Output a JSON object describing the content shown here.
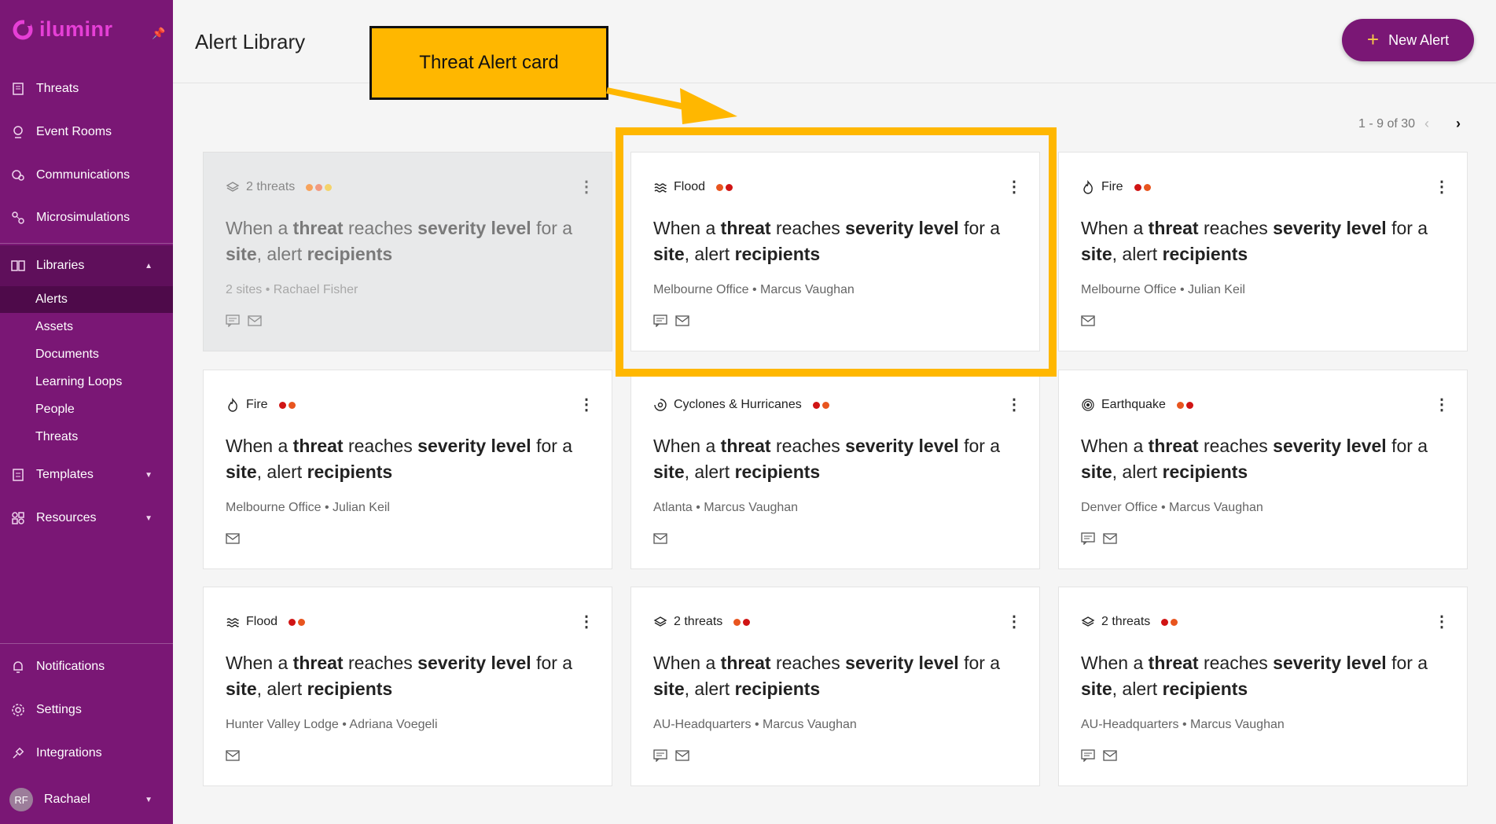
{
  "sidebar": {
    "brand": "iluminr",
    "items": [
      {
        "label": "Threats",
        "icon": "threats-icon"
      },
      {
        "label": "Event Rooms",
        "icon": "event-rooms-icon"
      },
      {
        "label": "Communications",
        "icon": "communications-icon"
      },
      {
        "label": "Microsimulations",
        "icon": "microsimulations-icon"
      },
      {
        "label": "Libraries",
        "icon": "libraries-icon"
      }
    ],
    "library_sub": [
      "Alerts",
      "Assets",
      "Documents",
      "Learning Loops",
      "People",
      "Threats"
    ],
    "templates": "Templates",
    "resources": "Resources",
    "bottom": [
      "Notifications",
      "Settings",
      "Integrations"
    ],
    "user": {
      "initials": "RF",
      "name": "Rachael"
    }
  },
  "header": {
    "title": "Alert Library",
    "new_alert": "New Alert"
  },
  "pagination": {
    "text": "1 - 9 of 30"
  },
  "annotation": {
    "label": "Threat Alert card",
    "color": "#ffb700"
  },
  "rule_text": {
    "when": "When a ",
    "threat": "threat",
    "reaches": " reaches ",
    "severity": "severity level",
    "for": " for a",
    "site": "site",
    "comma": ", alert ",
    "recipients": "recipients"
  },
  "cards": [
    {
      "tag": "2 threats",
      "icon": "layers-icon",
      "dots": [
        "#f7a35c",
        "#f29a80",
        "#f4d36b"
      ],
      "meta": "2 sites • Rachael Fisher",
      "channels": [
        "sms",
        "email"
      ],
      "disabled": true
    },
    {
      "tag": "Flood",
      "icon": "flood-icon",
      "dots": [
        "#e8551f",
        "#d01414"
      ],
      "meta": "Melbourne Office • Marcus Vaughan",
      "channels": [
        "sms",
        "email"
      ]
    },
    {
      "tag": "Fire",
      "icon": "fire-icon",
      "dots": [
        "#d01414",
        "#e8551f"
      ],
      "meta": "Melbourne Office • Julian Keil",
      "channels": [
        "email"
      ]
    },
    {
      "tag": "Fire",
      "icon": "fire-icon",
      "dots": [
        "#d01414",
        "#e8551f"
      ],
      "meta": "Melbourne Office • Julian Keil",
      "channels": [
        "email"
      ]
    },
    {
      "tag": "Cyclones & Hurricanes",
      "icon": "cyclone-icon",
      "dots": [
        "#d01414",
        "#e8551f"
      ],
      "meta": "Atlanta • Marcus Vaughan",
      "channels": [
        "email"
      ]
    },
    {
      "tag": "Earthquake",
      "icon": "earthquake-icon",
      "dots": [
        "#e8551f",
        "#d01414"
      ],
      "meta": "Denver Office • Marcus Vaughan",
      "channels": [
        "sms",
        "email"
      ]
    },
    {
      "tag": "Flood",
      "icon": "flood-icon",
      "dots": [
        "#d01414",
        "#e8551f"
      ],
      "meta": "Hunter Valley Lodge • Adriana Voegeli",
      "channels": [
        "email"
      ]
    },
    {
      "tag": "2 threats",
      "icon": "layers-icon",
      "dots": [
        "#e8551f",
        "#d01414"
      ],
      "meta": "AU-Headquarters • Marcus Vaughan",
      "channels": [
        "sms",
        "email"
      ]
    },
    {
      "tag": "2 threats",
      "icon": "layers-icon",
      "dots": [
        "#d01414",
        "#e8551f"
      ],
      "meta": "AU-Headquarters • Marcus Vaughan",
      "channels": [
        "sms",
        "email"
      ]
    }
  ]
}
